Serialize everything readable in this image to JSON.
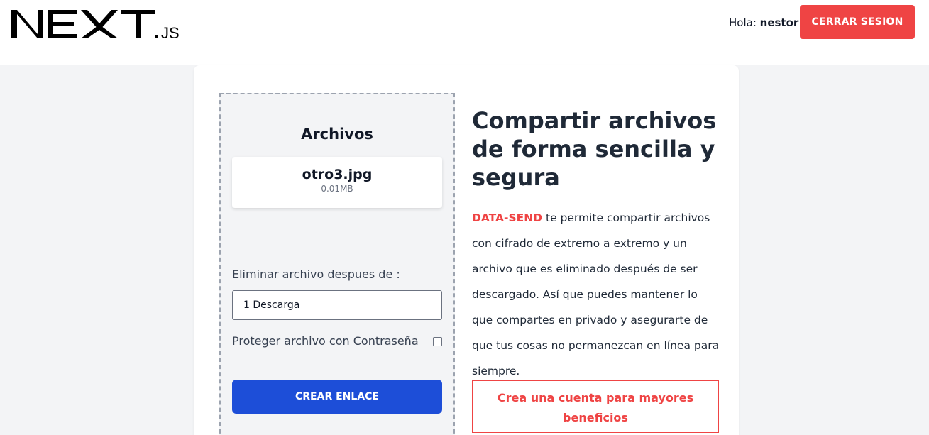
{
  "header": {
    "logo_alt": "NEXT.JS",
    "greeting_prefix": "Hola: ",
    "username": "nestor",
    "logout_label": "CERRAR SESION"
  },
  "upload": {
    "title": "Archivos",
    "files": [
      {
        "name": "otro3.jpg",
        "size": "0.01MB"
      }
    ],
    "expire_label": "Eliminar archivo despues de :",
    "expire_selected": "1 Descarga",
    "password_label": "Proteger archivo con Contraseña",
    "password_checked": false,
    "create_label": "CREAR ENLACE"
  },
  "info": {
    "headline": "Compartir archivos de forma sencilla y segura",
    "brand": "DATA-SEND",
    "description": " te permite compartir archivos con cifrado de extremo a extremo y un archivo que es eliminado después de ser descargado. Así que puedes mantener lo que compartes en privado y asegurarte de que tus cosas no permanezcan en línea para siempre.",
    "signup_link": "Crea una cuenta para mayores beneficios"
  },
  "colors": {
    "accent_red": "#ef4444",
    "primary_blue": "#1d4ed8",
    "page_bg": "#f3f4f6"
  }
}
